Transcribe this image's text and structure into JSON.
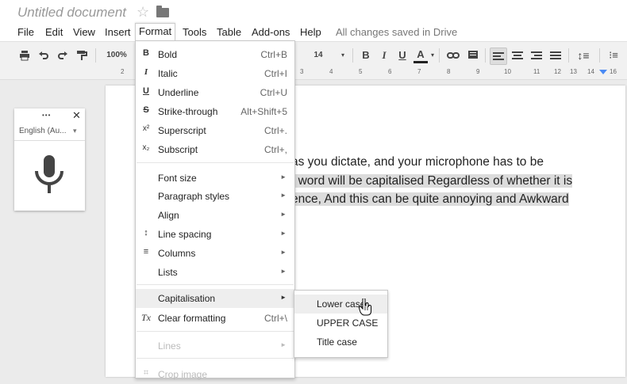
{
  "doc": {
    "title": "Untitled document",
    "star_icon": "star-outline-icon",
    "folder_icon": "folder-icon"
  },
  "menubar": {
    "items": [
      "File",
      "Edit",
      "View",
      "Insert",
      "Format",
      "Tools",
      "Table",
      "Add-ons",
      "Help"
    ],
    "active": "Format",
    "save_status": "All changes saved in Drive"
  },
  "toolbar": {
    "zoom": "100%",
    "font_size": "14",
    "bold": "B",
    "italic": "I",
    "underline": "U",
    "text_color": "A",
    "icons": [
      "print-icon",
      "undo-icon",
      "redo-icon",
      "paint-format-icon",
      "link-icon",
      "comment-icon",
      "align-left-icon",
      "align-center-icon",
      "align-right-icon",
      "align-justify-icon",
      "line-spacing-icon",
      "numbered-list-icon"
    ]
  },
  "ruler": {
    "labels": [
      "2",
      "1",
      "1",
      "2",
      "3",
      "4",
      "5",
      "6",
      "7",
      "8",
      "9",
      "10",
      "11",
      "12",
      "13",
      "14",
      "15",
      "16"
    ]
  },
  "document": {
    "lines": [
      {
        "parts": [
          "as you dictate, and your microphone has to be"
        ],
        "highlight": false
      },
      {
        "parts": [
          "t word will be capitalised Regardless of whether it is"
        ],
        "highlight": true
      },
      {
        "parts": [
          "ence, And this can be quite annoying and Awkward"
        ],
        "highlight": true
      }
    ]
  },
  "voice_typing": {
    "language": "English (Au...",
    "dropdown_arrow": "▾",
    "more_icon": "•••",
    "close_icon": "✕",
    "mic_icon": "microphone-icon"
  },
  "format_menu": {
    "items": [
      {
        "label": "Bold",
        "shortcut": "Ctrl+B",
        "icon": "B"
      },
      {
        "label": "Italic",
        "shortcut": "Ctrl+I",
        "icon": "I"
      },
      {
        "label": "Underline",
        "shortcut": "Ctrl+U",
        "icon": "U"
      },
      {
        "label": "Strike-through",
        "shortcut": "Alt+Shift+5",
        "icon": "S"
      },
      {
        "label": "Superscript",
        "shortcut": "Ctrl+.",
        "icon": "x²"
      },
      {
        "label": "Subscript",
        "shortcut": "Ctrl+,",
        "icon": "x₂"
      },
      {
        "label": "Font size",
        "submenu": true
      },
      {
        "label": "Paragraph styles",
        "submenu": true
      },
      {
        "label": "Align",
        "submenu": true
      },
      {
        "label": "Line spacing",
        "submenu": true,
        "icon": "↕"
      },
      {
        "label": "Columns",
        "submenu": true,
        "icon": "≡"
      },
      {
        "label": "Lists",
        "submenu": true
      },
      {
        "label": "Capitalisation",
        "submenu": true,
        "highlighted": true
      },
      {
        "label": "Clear formatting",
        "shortcut": "Ctrl+\\",
        "icon": "Tx"
      },
      {
        "label": "Lines",
        "submenu": true,
        "disabled": true
      },
      {
        "label": "Crop image",
        "disabled": true
      }
    ]
  },
  "capitalisation_submenu": {
    "items": [
      {
        "label": "Lower case",
        "hovered": true
      },
      {
        "label": "UPPER CASE"
      },
      {
        "label": "Title case"
      }
    ]
  },
  "colors": {
    "accent_blue": "#4a8af4",
    "hover_gray": "#eeeeee",
    "selection_gray": "#dcdcdc",
    "text_color_underline": "#cc0000"
  }
}
